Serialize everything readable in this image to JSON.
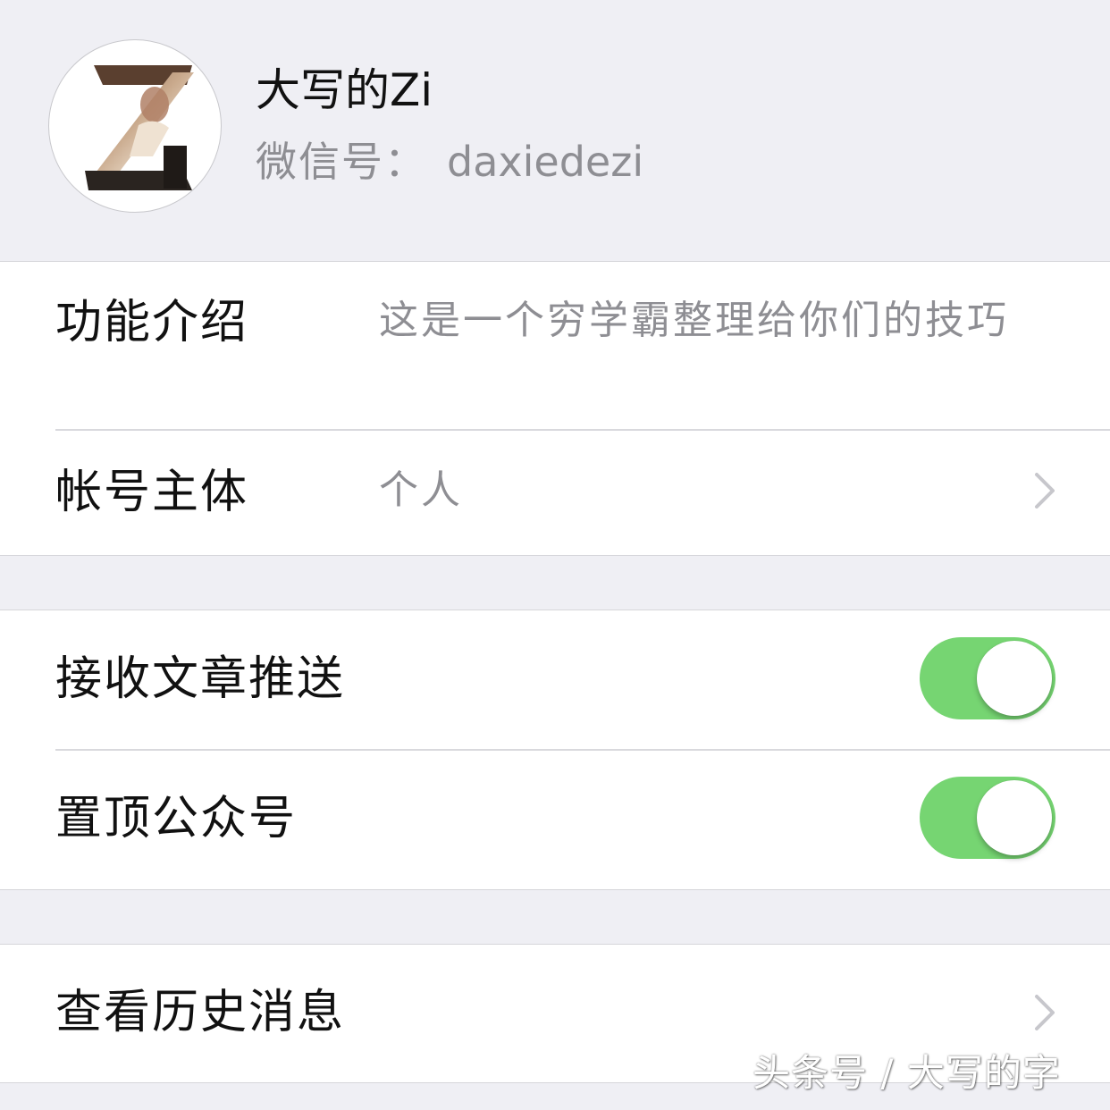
{
  "profile": {
    "name": "大写的Zi",
    "wechat_id_label": "微信号：",
    "wechat_id": "daxiedezi",
    "avatar_letter": "Z"
  },
  "info_group": {
    "intro_label": "功能介绍",
    "intro_value": "这是一个穷学霸整理给你们的技巧",
    "entity_label": "帐号主体",
    "entity_value": "个人"
  },
  "settings_group": {
    "receive_push_label": "接收文章推送",
    "receive_push_on": true,
    "pin_label": "置顶公众号",
    "pin_on": true
  },
  "history_group": {
    "history_label": "查看历史消息"
  },
  "watermark": "头条号 / 大写的字",
  "colors": {
    "background": "#efeff4",
    "toggle_on": "#76d572",
    "secondary_text": "#8e8e93",
    "chevron": "#c7c7cc"
  },
  "icons": {
    "chevron": "chevron-right-icon",
    "avatar": "z-letter-portrait-logo"
  }
}
